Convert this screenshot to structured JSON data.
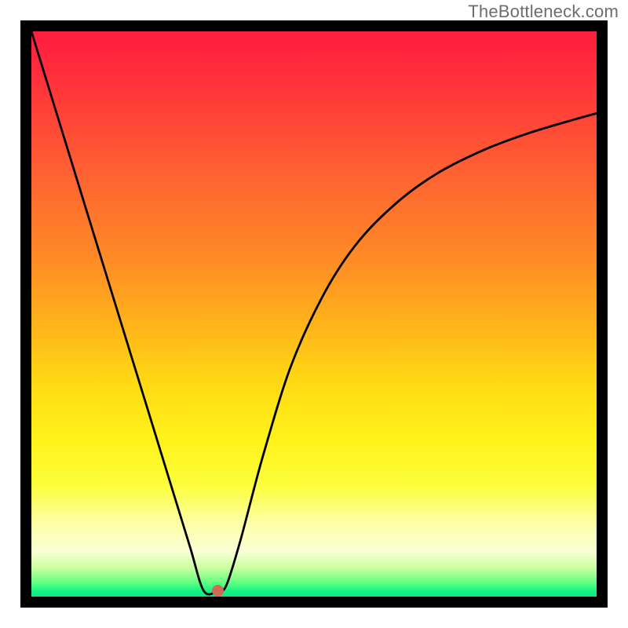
{
  "watermark": {
    "text": "TheBottleneck.com"
  },
  "chart_data": {
    "type": "line",
    "title": "",
    "xlabel": "",
    "ylabel": "",
    "xlim": [
      0,
      100
    ],
    "ylim": [
      0,
      100
    ],
    "grid": false,
    "series": [
      {
        "name": "curve",
        "x": [
          0,
          4,
          8,
          12,
          16,
          20,
          24,
          28,
          30.5,
          33,
          34.5,
          37,
          41,
          46,
          52,
          58,
          65,
          72,
          80,
          88,
          96,
          100
        ],
        "y": [
          100,
          87,
          74,
          61,
          48,
          35,
          22,
          9,
          1,
          1,
          2,
          10,
          25,
          41,
          54,
          63,
          70,
          75,
          79,
          82,
          84.4,
          85.5
        ]
      }
    ],
    "valley_marker": {
      "x": 33,
      "y": 1,
      "color": "#d06a56"
    },
    "background_gradient": {
      "top": "#ff1d3f",
      "mid": "#ffd914",
      "bottom": "#0ee887",
      "direction": "vertical"
    },
    "notes": "V-shaped curve with sharp minimum near x≈33; right branch rises and flattens near y≈85 at the right edge."
  }
}
